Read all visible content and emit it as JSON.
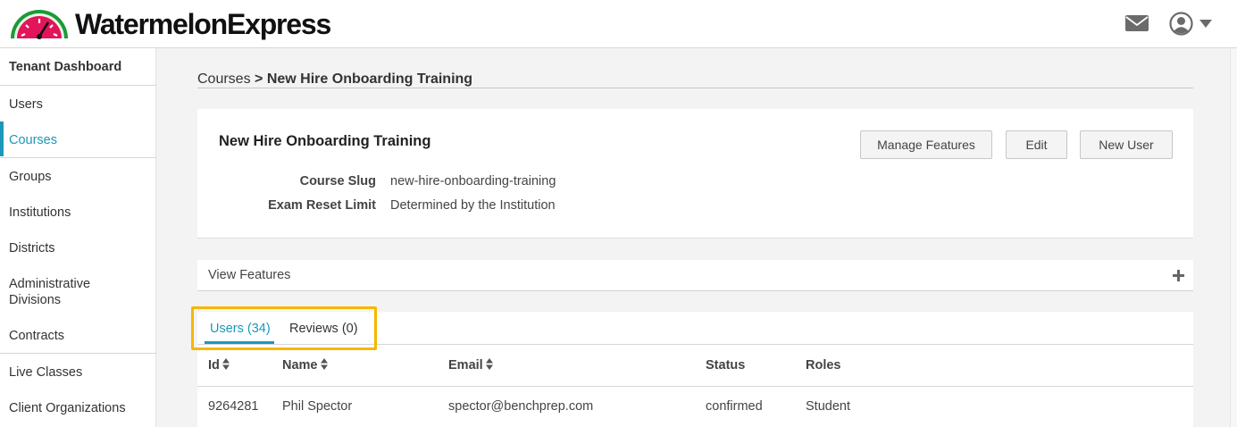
{
  "header": {
    "brand": "WatermelonExpress",
    "icons": {
      "mail": "mail-icon",
      "user": "user-circle-icon",
      "menu": "caret-down-icon"
    },
    "brand_color": "#e4145a"
  },
  "sidebar": {
    "title": "Tenant Dashboard",
    "items": [
      {
        "label": "Users"
      },
      {
        "label": "Courses",
        "active": true
      },
      {
        "label": "Groups"
      },
      {
        "label": "Institutions"
      },
      {
        "label": "Districts"
      },
      {
        "label": "Administrative Divisions"
      },
      {
        "label": "Contracts"
      },
      {
        "label": "Live Classes"
      },
      {
        "label": "Client Organizations"
      }
    ],
    "accent_color": "#1b98b8"
  },
  "breadcrumb": {
    "parent": "Courses",
    "separator": ">",
    "current": "New Hire Onboarding Training"
  },
  "course": {
    "title": "New Hire Onboarding Training",
    "buttons": {
      "manage_features": "Manage Features",
      "edit": "Edit",
      "new_user": "New User"
    },
    "details": [
      {
        "key": "Course Slug",
        "value": "new-hire-onboarding-training"
      },
      {
        "key": "Exam Reset Limit",
        "value": "Determined by the Institution"
      }
    ]
  },
  "features": {
    "label": "View Features",
    "toggle_icon": "plus-icon"
  },
  "tabs": [
    {
      "label": "Users (34)",
      "active": true
    },
    {
      "label": "Reviews (0)",
      "active": false
    }
  ],
  "highlight_color": "#f5b700",
  "table": {
    "columns": [
      {
        "label": "Id",
        "sortable": true
      },
      {
        "label": "Name",
        "sortable": true
      },
      {
        "label": "Email",
        "sortable": true
      },
      {
        "label": "Status",
        "sortable": false
      },
      {
        "label": "Roles",
        "sortable": false
      }
    ],
    "rows": [
      {
        "id": "9264281",
        "name": "Phil Spector",
        "email": "spector@benchprep.com",
        "status": "confirmed",
        "roles": "Student"
      }
    ]
  }
}
